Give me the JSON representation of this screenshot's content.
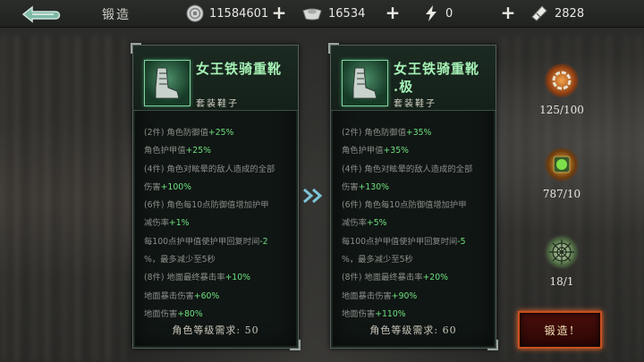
{
  "header": {
    "title": "锻造",
    "silver": "11584601",
    "ingot": "16534",
    "stamina": "0",
    "ticket": "2828"
  },
  "left_item": {
    "name_line1": "女王铁骑重靴",
    "name_line2": "",
    "subtitle": "套装鞋子",
    "stats": [
      [
        {
          "t": "(2件) 角色防御值",
          "c": "gray"
        },
        {
          "t": "+25%",
          "c": "green"
        }
      ],
      [
        {
          "t": "角色护甲值",
          "c": "gray"
        },
        {
          "t": "+25%",
          "c": "green"
        }
      ],
      [
        {
          "t": "(4件) 角色对眩晕的敌人造成的全部",
          "c": "gray"
        }
      ],
      [
        {
          "t": "伤害",
          "c": "gray"
        },
        {
          "t": "+100%",
          "c": "green"
        }
      ],
      [
        {
          "t": "(6件) 角色每10点防御值增加护甲",
          "c": "gray"
        }
      ],
      [
        {
          "t": "减伤率",
          "c": "gray"
        },
        {
          "t": "+1%",
          "c": "green"
        }
      ],
      [
        {
          "t": "每100点护甲值使护甲回复时间",
          "c": "gray"
        },
        {
          "t": "-2",
          "c": "green"
        }
      ],
      [
        {
          "t": "%，最多减少至5秒",
          "c": "gray"
        }
      ],
      [
        {
          "t": "(8件) 地面最终暴击率",
          "c": "gray"
        },
        {
          "t": "+10%",
          "c": "green"
        }
      ],
      [
        {
          "t": "地面暴击伤害",
          "c": "gray"
        },
        {
          "t": "+60%",
          "c": "green"
        }
      ],
      [
        {
          "t": "地面伤害",
          "c": "gray"
        },
        {
          "t": "+80%",
          "c": "green"
        }
      ]
    ],
    "requirement": "角色等级需求: 50"
  },
  "right_item": {
    "name_line1": "女王铁骑重靴",
    "name_line2": ".极",
    "subtitle": "套装鞋子",
    "stats": [
      [
        {
          "t": "(2件) 角色防御值",
          "c": "gray"
        },
        {
          "t": "+35%",
          "c": "green"
        }
      ],
      [
        {
          "t": "角色护甲值",
          "c": "gray"
        },
        {
          "t": "+35%",
          "c": "green"
        }
      ],
      [
        {
          "t": "(4件) 角色对眩晕的敌人造成的全部",
          "c": "gray"
        }
      ],
      [
        {
          "t": "伤害",
          "c": "gray"
        },
        {
          "t": "+130%",
          "c": "green"
        }
      ],
      [
        {
          "t": "(6件) 角色每10点防御值增加护甲",
          "c": "gray"
        }
      ],
      [
        {
          "t": "减伤率",
          "c": "gray"
        },
        {
          "t": "+5%",
          "c": "green"
        }
      ],
      [
        {
          "t": "每100点护甲值使护甲回复时间",
          "c": "gray"
        },
        {
          "t": "-5",
          "c": "green"
        }
      ],
      [
        {
          "t": "%，最多减少至5秒",
          "c": "gray"
        }
      ],
      [
        {
          "t": "(8件) 地面最终暴击率",
          "c": "gray"
        },
        {
          "t": "+20%",
          "c": "green"
        }
      ],
      [
        {
          "t": "地面暴击伤害",
          "c": "gray"
        },
        {
          "t": "+90%",
          "c": "green"
        }
      ],
      [
        {
          "t": "地面伤害",
          "c": "gray"
        },
        {
          "t": "+110%",
          "c": "green"
        }
      ]
    ],
    "requirement": "角色等级需求: 60"
  },
  "materials": [
    {
      "name": "chain-ring-icon",
      "count": "125/100"
    },
    {
      "name": "green-gem-icon",
      "count": "787/10"
    },
    {
      "name": "spider-web-icon",
      "count": "18/1"
    }
  ],
  "forge_button": "锻造!",
  "colors": {
    "stat_green": "#6ee07d",
    "stat_gray": "#8c8d88",
    "name_green": "#a6f2b6",
    "forge_border": "#c8501e"
  }
}
